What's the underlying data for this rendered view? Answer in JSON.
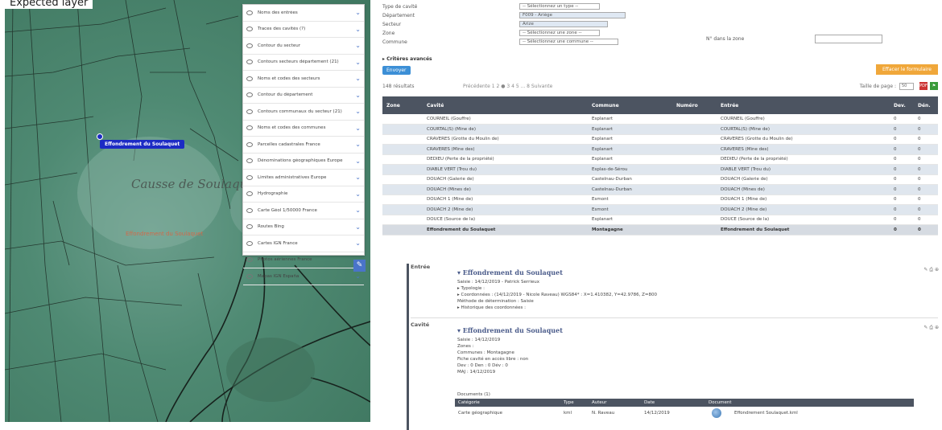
{
  "caption": "Expected layer",
  "map": {
    "place": "Causse de Soulaquet",
    "place2": "Effondrement du Soulaquet",
    "marker": "Effondrement du Soulaquet",
    "layers": [
      "Noms des entrées",
      "Traces des cavités (?)",
      "Contour du secteur",
      "Contours secteurs département (21)",
      "Noms et codes des secteurs",
      "Contour du département",
      "Contours communaux du secteur (21)",
      "Noms et codes des communes",
      "Parcelles cadastrales France",
      "Dénominations géographiques Europe",
      "Limites administratives Europe",
      "Hydrographie",
      "Carte Géol 1/50000 France",
      "Routes Bing",
      "Cartes IGN France",
      "Photos aériennes France",
      "Mapas IGN España"
    ]
  },
  "form": {
    "type_label": "Type de cavité",
    "type_value": "-- Sélectionnez un type --",
    "dept_label": "Département",
    "dept_value": "F009 - Ariège",
    "sect_label": "Secteur",
    "sect_value": "Arize",
    "zone_label": "Zone",
    "zone_value": "-- Sélectionnez une zone --",
    "commune_label": "Commune",
    "commune_value": "-- Sélectionnez une commune --",
    "zone_no_label": "N° dans la zone",
    "criteria": "▸ Critères avancés",
    "send": "Envoyer",
    "clear": "Effacer le formulaire"
  },
  "results": {
    "count": "148 résultats",
    "pager": "Précédente   1 2 ● 3 4 5 ... 8   Suivante",
    "page_size_label": "Taille de page :",
    "page_size": "50",
    "headers": [
      "Zone",
      "Cavité",
      "Commune",
      "Numéro",
      "Entrée",
      "Dev.",
      "Dén."
    ],
    "rows": [
      [
        "",
        "COURNEIL (Gouffre)",
        "Esplanart",
        "",
        "COURNEIL (Gouffre)",
        "0",
        "0"
      ],
      [
        "",
        "COURTAL(S) (Mine de)",
        "Esplanart",
        "",
        "COURTAL(S) (Mine de)",
        "0",
        "0"
      ],
      [
        "",
        "CRAVERES (Grotte du Moulin de)",
        "Esplanart",
        "",
        "CRAVERES (Grotte du Moulin de)",
        "0",
        "0"
      ],
      [
        "",
        "CRAVERES (Mine des)",
        "Esplanart",
        "",
        "CRAVERES (Mine des)",
        "0",
        "0"
      ],
      [
        "",
        "DEDIEU (Perte de la propriété)",
        "Esplanart",
        "",
        "DEDIEU (Perte de la propriété)",
        "0",
        "0"
      ],
      [
        "",
        "DIABLE VERT (Trou du)",
        "Esplas-de-Sérou",
        "",
        "DIABLE VERT (Trou du)",
        "0",
        "0"
      ],
      [
        "",
        "DOUACH (Galerie de)",
        "Castelnau-Durban",
        "",
        "DOUACH (Galerie de)",
        "0",
        "0"
      ],
      [
        "",
        "DOUACH (Mines de)",
        "Castelnau-Durban",
        "",
        "DOUACH (Mines de)",
        "0",
        "0"
      ],
      [
        "",
        "DOUACH 1 (Mine de)",
        "Esmont",
        "",
        "DOUACH 1 (Mine de)",
        "0",
        "0"
      ],
      [
        "",
        "DOUACH 2 (Mine de)",
        "Esmont",
        "",
        "DOUACH 2 (Mine de)",
        "0",
        "0"
      ],
      [
        "",
        "DOUCE (Source de la)",
        "Esplanart",
        "",
        "DOUCE (Source de la)",
        "0",
        "0"
      ],
      [
        "",
        "Effondrement du Soulaquet",
        "Montagagne",
        "",
        "Effondrement du Soulaquet",
        "0",
        "0"
      ]
    ]
  },
  "detail": {
    "entree_tag": "Entrée",
    "entree_title": "▾ Effondrement du Soulaquet",
    "entree_lines": [
      "Saisie : 14/12/2019 - Patrick Serrieux",
      "▸ Typologie :",
      "▸ Coordonnées : (14/12/2019 - Nicole Raveau) WGS84* : X=1.410382, Y=42.9786, Z=800",
      "Méthode de détermination : Saisie",
      "▸ Historique des coordonnées :"
    ],
    "cavite_tag": "Cavité",
    "cavite_title": "▾ Effondrement du Soulaquet",
    "cavite_lines": [
      "Saisie : 14/12/2019",
      "Zones :",
      "Communes : Montagagne",
      "Fiche cavité en accès libre : non",
      "Dev : 0  Den : 0  Dév : 0",
      "MAJ : 14/12/2019"
    ],
    "docs_label": "Documents (1)",
    "doc_headers": [
      "Catégorie",
      "Type",
      "Auteur",
      "Date",
      "Document"
    ],
    "doc_row": [
      "Carte géographique",
      "kml",
      "N. Raveau",
      "14/12/2019",
      "",
      "Effondrement Soulaquet.kml"
    ]
  }
}
